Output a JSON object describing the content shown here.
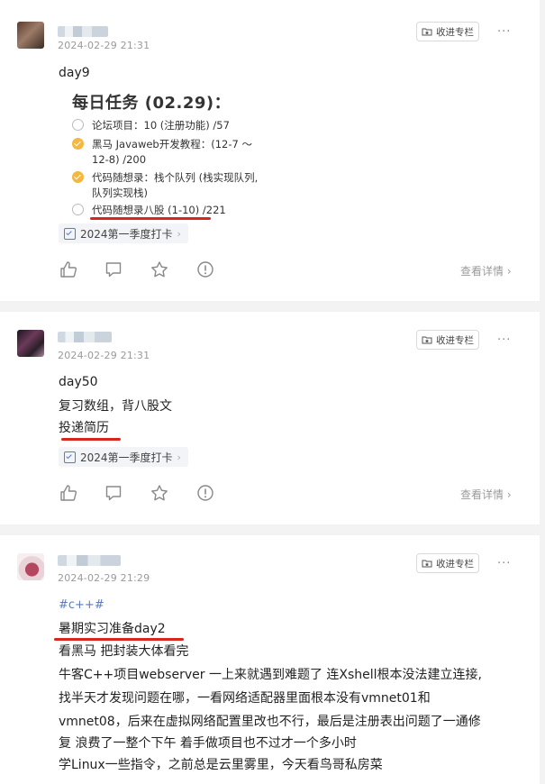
{
  "posts": [
    {
      "time": "2024-02-29 21:31",
      "fav_label": "收进专栏",
      "more": "···",
      "title": "day9",
      "task_header": "每日任务 (02.29)：",
      "tasks": [
        {
          "text": "论坛项目：10 (注册功能) /57",
          "done": false
        },
        {
          "text": "黑马 Javaweb开发教程：(12-7 ～ 12-8) /200",
          "done": true
        },
        {
          "text": "代码随想录：栈个队列 (栈实现队列, 队列实现栈)",
          "done": true
        },
        {
          "text": "代码随想录八股 (1-10) /221",
          "done": false
        }
      ],
      "topic": "2024第一季度打卡",
      "view_detail": "查看详情"
    },
    {
      "time": "2024-02-29 21:31",
      "fav_label": "收进专栏",
      "more": "···",
      "lines": [
        "day50",
        "复习数组，背八股文",
        "投递简历"
      ],
      "topic": "2024第一季度打卡",
      "view_detail": "查看详情"
    },
    {
      "time": "2024-02-29 21:29",
      "fav_label": "收进专栏",
      "more": "···",
      "hashtag": "#c++#",
      "lines": [
        "暑期实习准备day2",
        "看黑马 把封装大体看完",
        "牛客C++项目webserver 一上来就遇到难题了 连Xshell根本没法建立连接,",
        "找半天才发现问题在哪，一看网络适配器里面根本没有vmnet01和",
        "vmnet08，后来在虚拟网络配置里改也不行，最后是注册表出问题了一通修",
        "复 浪费了一整个下午 着手做项目也不过才一个多小时",
        "学Linux一些指令，之前总是云里雾里，今天看鸟哥私房菜"
      ]
    }
  ],
  "colors": {
    "accent_underline": "#d7261e",
    "check_done": "#f4b73f",
    "calendar": "#3f7ef7",
    "hashtag": "#5b7db8"
  },
  "icons": [
    "like-icon",
    "comment-icon",
    "star-icon",
    "report-icon",
    "calendar-check-icon",
    "folder-star-icon",
    "chevron-right-icon"
  ]
}
